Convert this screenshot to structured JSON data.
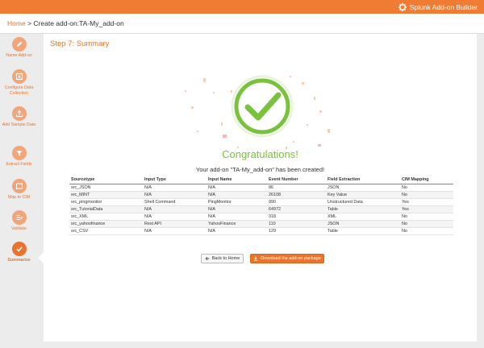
{
  "app": {
    "brand_name": "Splunk Add-on Builder"
  },
  "breadcrumb": {
    "home": "Home",
    "separator": ">",
    "current": "Create add-on:TA-My_add-on"
  },
  "sidebar": {
    "steps": [
      {
        "label": "Name Add-on",
        "icon": "pencil-icon"
      },
      {
        "label": "Configure Data Collection",
        "icon": "data-input-icon"
      },
      {
        "label": "Add Sample Data",
        "icon": "upload-icon"
      },
      {
        "label": "Extract Fields",
        "icon": "filter-icon"
      },
      {
        "label": "Map to CIM",
        "icon": "map-icon"
      },
      {
        "label": "Validate",
        "icon": "validate-icon"
      },
      {
        "label": "Summarize",
        "icon": "check-icon",
        "active": true
      }
    ]
  },
  "main": {
    "step_title": "Step 7: Summary",
    "congrats": "Congratulations!",
    "created_message": "Your add-on \"TA-My_add-on\" has been created!",
    "table": {
      "headers": [
        "Sourcetype",
        "Input Type",
        "Input Name",
        "Event Number",
        "Field Extraction",
        "CIM Mapping"
      ],
      "rows": [
        [
          "src_JSON",
          "N/A",
          "N/A",
          "86",
          "JSON",
          "No"
        ],
        [
          "src_MINT",
          "N/A",
          "N/A",
          "26108",
          "Key Value",
          "No"
        ],
        [
          "src_pingmonitor",
          "Shell Command",
          "PingMonitor",
          "990",
          "Unstructured Data",
          "Yes"
        ],
        [
          "src_TutorialData",
          "N/A",
          "N/A",
          "64972",
          "Table",
          "Yes"
        ],
        [
          "src_XML",
          "N/A",
          "N/A",
          "318",
          "XML",
          "No"
        ],
        [
          "src_yahoofinance",
          "Rest API",
          "YahooFinance",
          "110",
          "JSON",
          "No"
        ],
        [
          "src_CSV",
          "N/A",
          "N/A",
          "129",
          "Table",
          "No"
        ]
      ]
    },
    "buttons": {
      "back_home": "Back to Home",
      "download": "Download the add-on package"
    }
  },
  "colors": {
    "accent": "#e8742d",
    "success": "#7ac23d",
    "accent_light": "#f0a57b"
  }
}
